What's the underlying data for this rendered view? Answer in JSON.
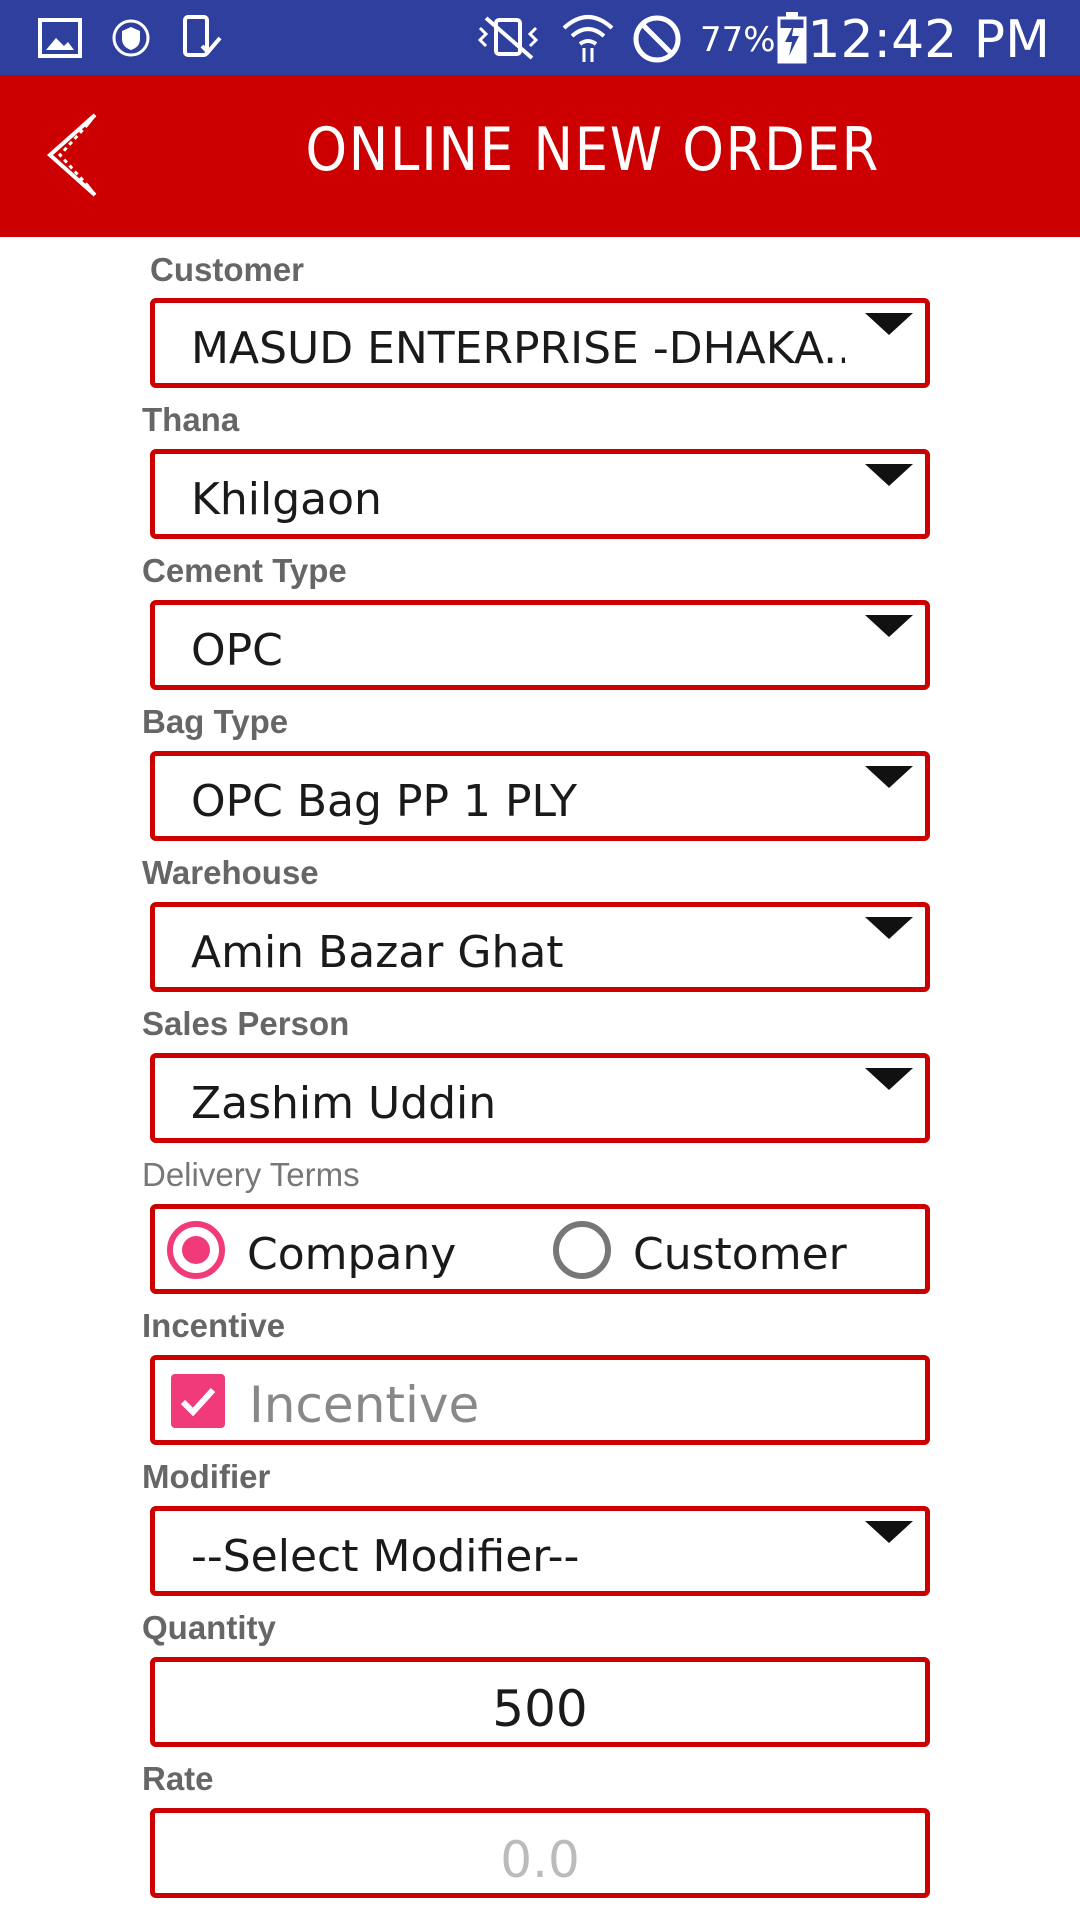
{
  "status_bar": {
    "battery_percent": "77%",
    "time": "12:42 PM",
    "icons": [
      "gallery-icon",
      "shield-icon",
      "phone-check-icon",
      "vibrate-off-icon",
      "wifi-icon",
      "no-disturb-icon",
      "battery-charging-icon"
    ]
  },
  "app_bar": {
    "title": "ONLINE NEW ORDER",
    "back_icon": "chevron-left-icon"
  },
  "colors": {
    "status_bar": "#2e3f9e",
    "app_bar": "#cc0000",
    "field_border": "#cc0000",
    "accent": "#f03a7a"
  },
  "form": {
    "customer": {
      "label": "Customer",
      "value": "MASUD ENTERPRISE -DHAKA.."
    },
    "thana": {
      "label": "Thana",
      "value": "Khilgaon"
    },
    "cement_type": {
      "label": "Cement Type",
      "value": "OPC"
    },
    "bag_type": {
      "label": "Bag Type",
      "value": "OPC Bag PP 1 PLY"
    },
    "warehouse": {
      "label": "Warehouse",
      "value": "Amin Bazar Ghat"
    },
    "sales_person": {
      "label": "Sales Person",
      "value": "Zashim Uddin"
    },
    "delivery_terms": {
      "label": "Delivery Terms",
      "options": [
        "Company",
        "Customer"
      ],
      "selected": "Company"
    },
    "incentive": {
      "label": "Incentive",
      "checkbox_label": "Incentive",
      "checked": true
    },
    "modifier": {
      "label": "Modifier",
      "value": "--Select Modifier--"
    },
    "quantity": {
      "label": "Quantity",
      "value": "500"
    },
    "rate": {
      "label": "Rate",
      "placeholder": "0.0"
    }
  }
}
